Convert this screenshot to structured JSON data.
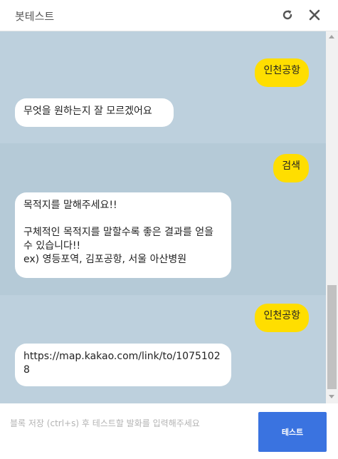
{
  "header": {
    "title": "봇테스트",
    "refresh_icon": "refresh-icon",
    "close_icon": "close-icon"
  },
  "messages": [
    {
      "role": "user",
      "text": "인천공항"
    },
    {
      "role": "bot",
      "text": "무엇을 원하는지 잘 모르겠어요"
    },
    {
      "role": "user",
      "text": "검색"
    },
    {
      "role": "bot",
      "text": "목적지를 말해주세요!!\n\n구체적인 목적지를 말할수록 좋은 결과를 얻을 수 있습니다!!\nex) 영등포역, 김포공항, 서울 아산병원"
    },
    {
      "role": "user",
      "text": "인천공항"
    },
    {
      "role": "bot",
      "text": "https://map.kakao.com/link/to/10751028"
    }
  ],
  "composer": {
    "placeholder": "블록 저장 (ctrl+s) 후 테스트할 발화를 입력해주세요",
    "send_label": "테스트"
  },
  "colors": {
    "user_bubble": "#ffde00",
    "bot_bubble": "#ffffff",
    "chat_background": "#bdd0dd",
    "send_button": "#3a73e0"
  }
}
